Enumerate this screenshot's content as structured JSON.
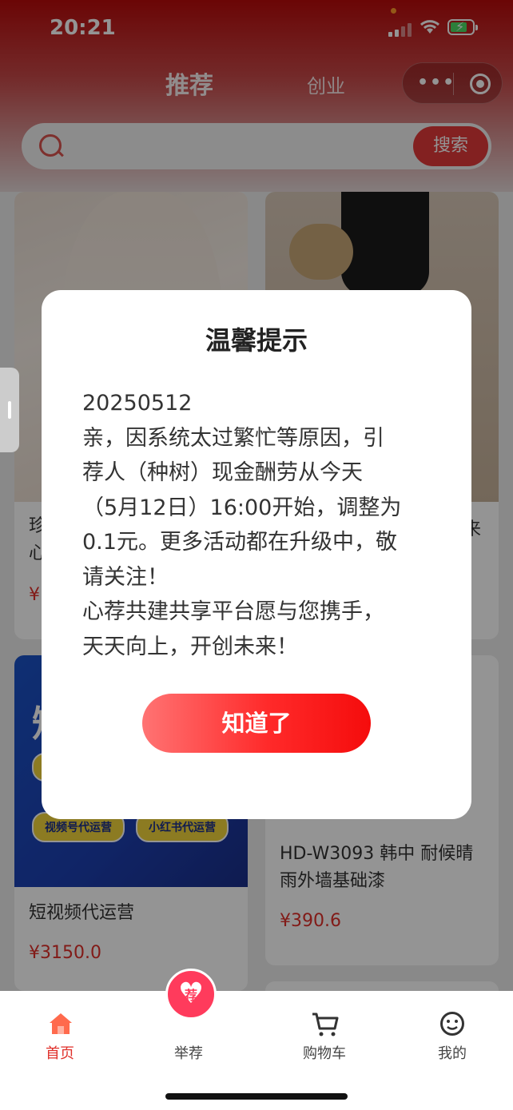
{
  "status": {
    "time": "20:21"
  },
  "header": {
    "tab_recommend": "推荐",
    "tab_business": "创业"
  },
  "search": {
    "placeholder": "",
    "button": "搜索"
  },
  "products": [
    {
      "title_fragment_line1": "珍",
      "title_fragment_line2": "心",
      "price_fragment": "¥"
    },
    {
      "title_fragment_line1": "来",
      "price_fragment": ""
    },
    {
      "banner_text": "短",
      "tags": [
        "视频号代运营",
        "小红书代运营"
      ],
      "title": "短视频代运营",
      "price": "¥3150.0"
    },
    {
      "title_line1": "HD-W3093 韩中 耐候晴",
      "title_line2": "雨外墙基础漆",
      "price": "¥390.6"
    }
  ],
  "modal": {
    "title": "温馨提示",
    "lines": [
      "20250512",
      "亲，因系统太过繁忙等原因，引",
      "荐人（种树）现金酬劳从今天",
      "（5月12日）16:00开始，调整为",
      "0.1元。更多活动都在升级中，敬",
      "请关注！",
      "心荐共建共享平台愿与您携手，",
      "天天向上，开创未来！"
    ],
    "confirm": "知道了"
  },
  "tabbar": {
    "home": "首页",
    "recommend": "举荐",
    "recommend_badge": "荐",
    "cart": "购物车",
    "mine": "我的"
  },
  "colors": {
    "brand": "#e0302a",
    "header": "#b80b0b",
    "button": "#ff2a2a"
  }
}
